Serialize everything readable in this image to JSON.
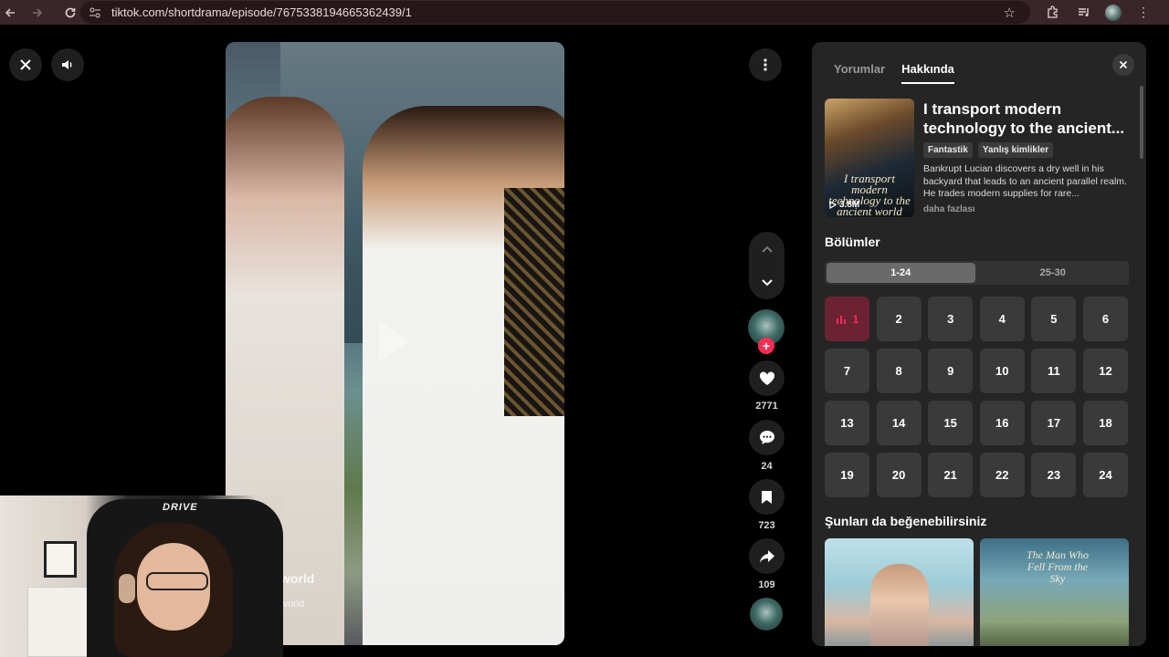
{
  "browser": {
    "url": "tiktok.com/shortdrama/episode/7675338194665362439/1"
  },
  "player": {
    "caption_title": "world",
    "caption_sub": "world"
  },
  "webcam": {
    "chair_logo": "DRIVE"
  },
  "actions": {
    "likes": "2771",
    "comments": "24",
    "saves": "723",
    "shares": "109"
  },
  "panel": {
    "tabs": [
      {
        "label": "Yorumlar",
        "active": false
      },
      {
        "label": "Hakkında",
        "active": true
      }
    ],
    "drama": {
      "cover_text": "I transport modern technology to the ancient world",
      "views": "3.8M",
      "title": "I transport modern technology to the ancient...",
      "tags": [
        "Fantastik",
        "Yanlış kimlikler"
      ],
      "description": "Bankrupt Lucian discovers a dry well in his backyard that leads to an ancient parallel realm. He trades modern supplies for rare...",
      "more_label": "daha fazlası"
    },
    "episodes_heading": "Bölümler",
    "ranges": [
      {
        "label": "1-24",
        "active": true
      },
      {
        "label": "25-30",
        "active": false
      }
    ],
    "episodes": [
      "1",
      "2",
      "3",
      "4",
      "5",
      "6",
      "7",
      "8",
      "9",
      "10",
      "11",
      "12",
      "13",
      "14",
      "15",
      "16",
      "17",
      "18",
      "19",
      "20",
      "21",
      "22",
      "23",
      "24"
    ],
    "current_episode": "1",
    "recs_heading": "Şunları da beğenebilirsiniz",
    "recs": [
      {
        "cover_text": ""
      },
      {
        "cover_text": "The Man Who Fell From the Sky"
      }
    ]
  },
  "colors": {
    "accent": "#fe2c55",
    "current_episode_bg": "#6b2233",
    "panel_bg": "#252525",
    "browser_bar": "#3a2629"
  }
}
